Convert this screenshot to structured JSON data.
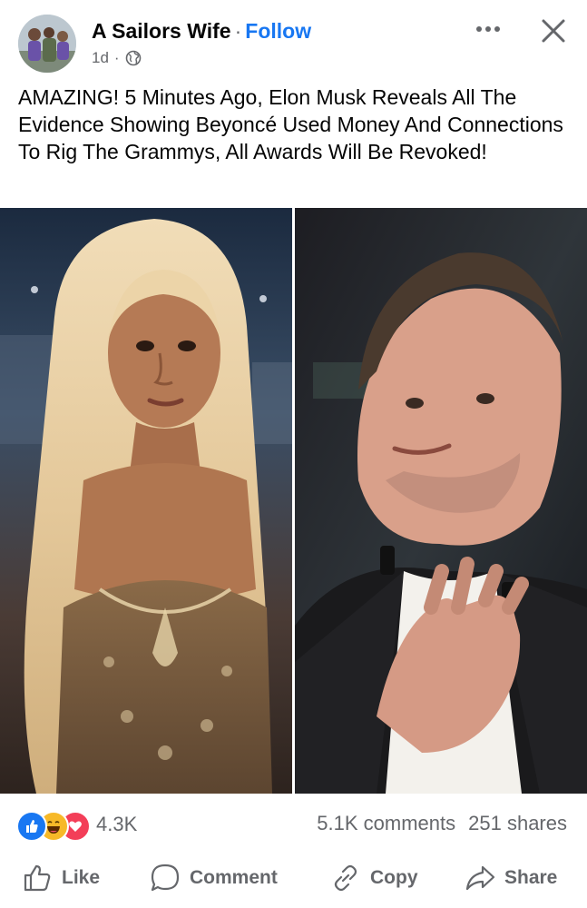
{
  "post": {
    "author": "A Sailors Wife",
    "separator": "·",
    "follow_label": "Follow",
    "time": "1d",
    "meta_separator": "·",
    "privacy_icon": "globe-icon",
    "more_icon": "more-options-icon",
    "close_icon": "close-icon",
    "text": "AMAZING! 5 Minutes Ago, Elon Musk Reveals All The Evidence Showing Beyoncé Used Money And Connections To Rig The Grammys, All Awards Will Be Revoked!"
  },
  "engagement": {
    "reaction_icons": [
      "like-reaction-icon",
      "haha-reaction-icon",
      "love-reaction-icon"
    ],
    "reaction_count": "4.3K",
    "comments": "5.1K comments",
    "shares": "251 shares"
  },
  "actions": {
    "like_label": "Like",
    "comment_label": "Comment",
    "copy_label": "Copy",
    "share_label": "Share"
  },
  "colors": {
    "accent": "#1877f2",
    "secondary_text": "#65676b",
    "like": "#1877f2",
    "haha": "#f7b928",
    "love": "#f33e58"
  }
}
